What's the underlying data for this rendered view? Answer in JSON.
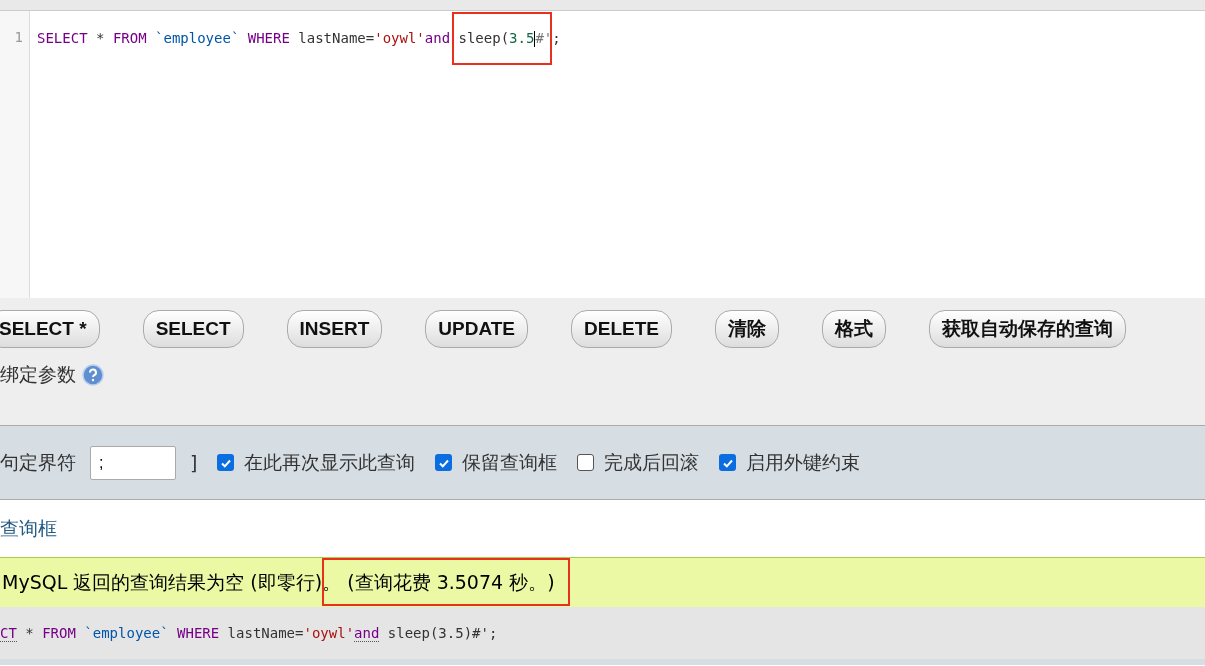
{
  "editor": {
    "line_number": "1",
    "tokens": [
      {
        "kind": "keyword",
        "text": "SELECT"
      },
      {
        "kind": "plain",
        "text": " * "
      },
      {
        "kind": "keyword",
        "text": "FROM"
      },
      {
        "kind": "identifier",
        "text": " `employee` "
      },
      {
        "kind": "keyword",
        "text": "WHERE"
      },
      {
        "kind": "plain",
        "text": " lastName="
      },
      {
        "kind": "string",
        "text": "'oywl'"
      },
      {
        "kind": "keyword",
        "text": "and"
      },
      {
        "kind": "plain",
        "text": " sleep("
      },
      {
        "kind": "number",
        "text": "3.5",
        "caret_after": true
      },
      {
        "kind": "comment",
        "text": "#'"
      },
      {
        "kind": "plain",
        "text": ";"
      }
    ]
  },
  "buttons": [
    "SELECT *",
    "SELECT",
    "INSERT",
    "UPDATE",
    "DELETE",
    "清除",
    "格式",
    "获取自动保存的查询"
  ],
  "bind_parameters": {
    "label": "绑定参数"
  },
  "options": {
    "delimiter_label": "句定界符",
    "delimiter_value": ";",
    "bracket": "]",
    "checkboxes": [
      {
        "label": "在此再次显示此查询",
        "checked": true
      },
      {
        "label": "保留查询框",
        "checked": true
      },
      {
        "label": "完成后回滚",
        "checked": false
      },
      {
        "label": "启用外键约束",
        "checked": true
      }
    ]
  },
  "link": "查询框",
  "message": {
    "text": "MySQL 返回的查询结果为空 (即零行)。 (查询花费 3.5074 秒。)"
  },
  "executed_sql": {
    "tokens": [
      {
        "kind": "keyword",
        "text": "CT",
        "underlined": true
      },
      {
        "kind": "plain",
        "text": " * "
      },
      {
        "kind": "keyword",
        "text": "FROM"
      },
      {
        "kind": "identifier",
        "text": " `employee` "
      },
      {
        "kind": "keyword",
        "text": "WHERE"
      },
      {
        "kind": "plain",
        "text": " lastName="
      },
      {
        "kind": "string",
        "text": "'oywl'"
      },
      {
        "kind": "keyword",
        "text": "and",
        "underlined": true
      },
      {
        "kind": "plain",
        "text": " sleep(3.5)#';"
      }
    ]
  }
}
